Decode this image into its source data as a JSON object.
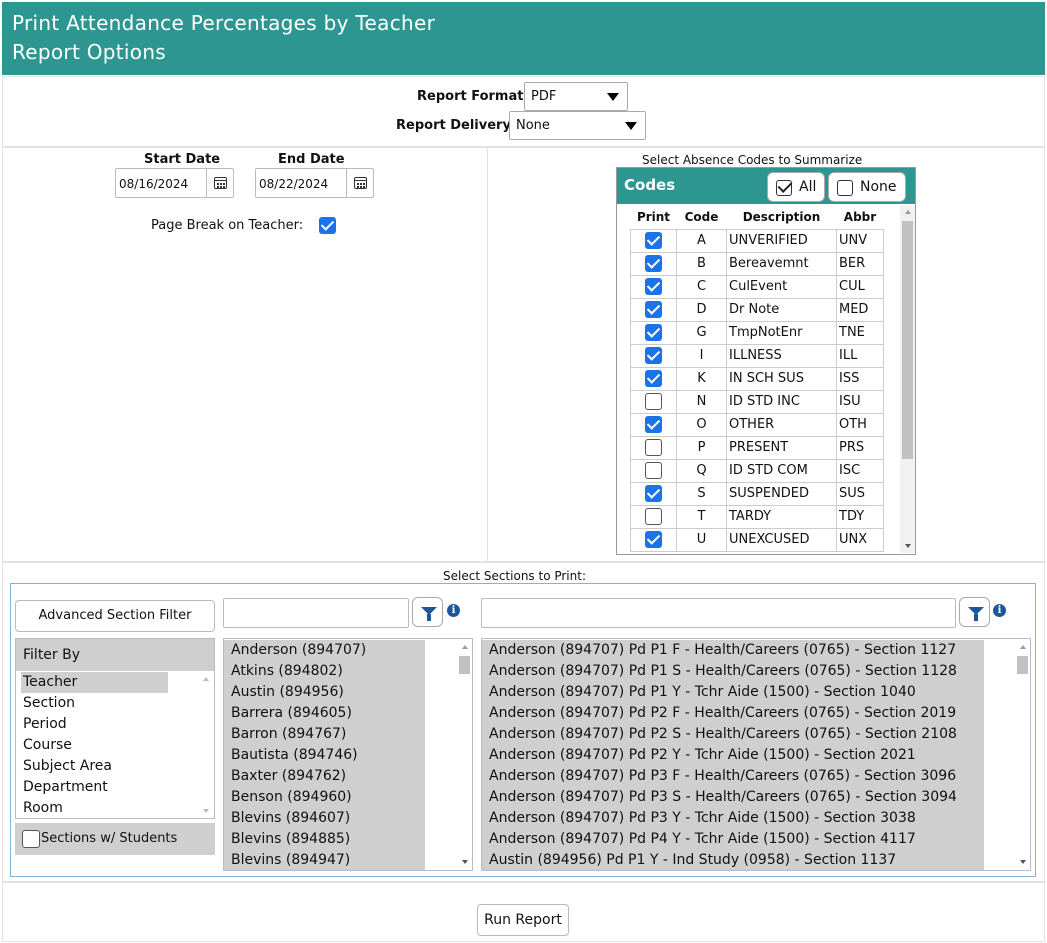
{
  "header": {
    "title": "Print Attendance Percentages by Teacher",
    "subtitle": "Report Options"
  },
  "report": {
    "format_label": "Report Format:",
    "format_value": "PDF",
    "delivery_label": "Report Delivery:",
    "delivery_value": "None"
  },
  "dates": {
    "start_label": "Start Date",
    "start_value": "08/16/2024",
    "end_label": "End Date",
    "end_value": "08/22/2024"
  },
  "page_break": {
    "label": "Page Break on Teacher:",
    "checked": true
  },
  "codes": {
    "section_title": "Select Absence Codes to Summarize",
    "panel_title": "Codes",
    "all_label": "All",
    "none_label": "None",
    "columns": [
      "Print",
      "Code",
      "Description",
      "Abbr"
    ],
    "rows": [
      {
        "print": true,
        "code": "A",
        "description": "UNVERIFIED",
        "abbr": "UNV"
      },
      {
        "print": true,
        "code": "B",
        "description": "Bereavemnt",
        "abbr": "BER"
      },
      {
        "print": true,
        "code": "C",
        "description": "CulEvent",
        "abbr": "CUL"
      },
      {
        "print": true,
        "code": "D",
        "description": "Dr Note",
        "abbr": "MED"
      },
      {
        "print": true,
        "code": "G",
        "description": "TmpNotEnr",
        "abbr": "TNE"
      },
      {
        "print": true,
        "code": "I",
        "description": "ILLNESS",
        "abbr": "ILL"
      },
      {
        "print": true,
        "code": "K",
        "description": "IN SCH SUS",
        "abbr": "ISS"
      },
      {
        "print": false,
        "code": "N",
        "description": "ID STD INC",
        "abbr": "ISU"
      },
      {
        "print": true,
        "code": "O",
        "description": "OTHER",
        "abbr": "OTH"
      },
      {
        "print": false,
        "code": "P",
        "description": "PRESENT",
        "abbr": "PRS"
      },
      {
        "print": false,
        "code": "Q",
        "description": "ID STD COM",
        "abbr": "ISC"
      },
      {
        "print": true,
        "code": "S",
        "description": "SUSPENDED",
        "abbr": "SUS"
      },
      {
        "print": false,
        "code": "T",
        "description": "TARDY",
        "abbr": "TDY"
      },
      {
        "print": true,
        "code": "U",
        "description": "UNEXCUSED",
        "abbr": "UNX"
      }
    ]
  },
  "sections": {
    "title": "Select Sections to Print:",
    "advanced_filter_label": "Advanced Section Filter",
    "filter_by_label": "Filter By",
    "filter_options": [
      "Teacher",
      "Section",
      "Period",
      "Course",
      "Subject Area",
      "Department",
      "Room"
    ],
    "filter_selected": "Teacher",
    "with_students_label": "Sections w/ Students",
    "teacher_search_value": "",
    "section_search_value": "",
    "teachers": [
      "Anderson (894707)",
      "Atkins (894802)",
      "Austin (894956)",
      "Barrera (894605)",
      "Barron (894767)",
      "Bautista (894746)",
      "Baxter (894762)",
      "Benson (894960)",
      "Blevins (894607)",
      "Blevins (894885)",
      "Blevins (894947)"
    ],
    "section_items": [
      "Anderson (894707) Pd P1 F - Health/Careers (0765) - Section 1127",
      "Anderson (894707) Pd P1 S - Health/Careers (0765) - Section 1128",
      "Anderson (894707) Pd P1 Y - Tchr Aide (1500) - Section 1040",
      "Anderson (894707) Pd P2 F - Health/Careers (0765) - Section 2019",
      "Anderson (894707) Pd P2 S - Health/Careers (0765) - Section 2108",
      "Anderson (894707) Pd P2 Y - Tchr Aide (1500) - Section 2021",
      "Anderson (894707) Pd P3 F - Health/Careers (0765) - Section 3096",
      "Anderson (894707) Pd P3 S - Health/Careers (0765) - Section 3094",
      "Anderson (894707) Pd P3 Y - Tchr Aide (1500) - Section 3038",
      "Anderson (894707) Pd P4 Y - Tchr Aide (1500) - Section 4117",
      "Austin (894956) Pd P1 Y - Ind Study (0958) - Section 1137"
    ]
  },
  "run_label": "Run Report",
  "colors": {
    "header_bg": "#2e9690",
    "checkbox": "#1a73e8",
    "filter_icon": "#1e5799"
  }
}
